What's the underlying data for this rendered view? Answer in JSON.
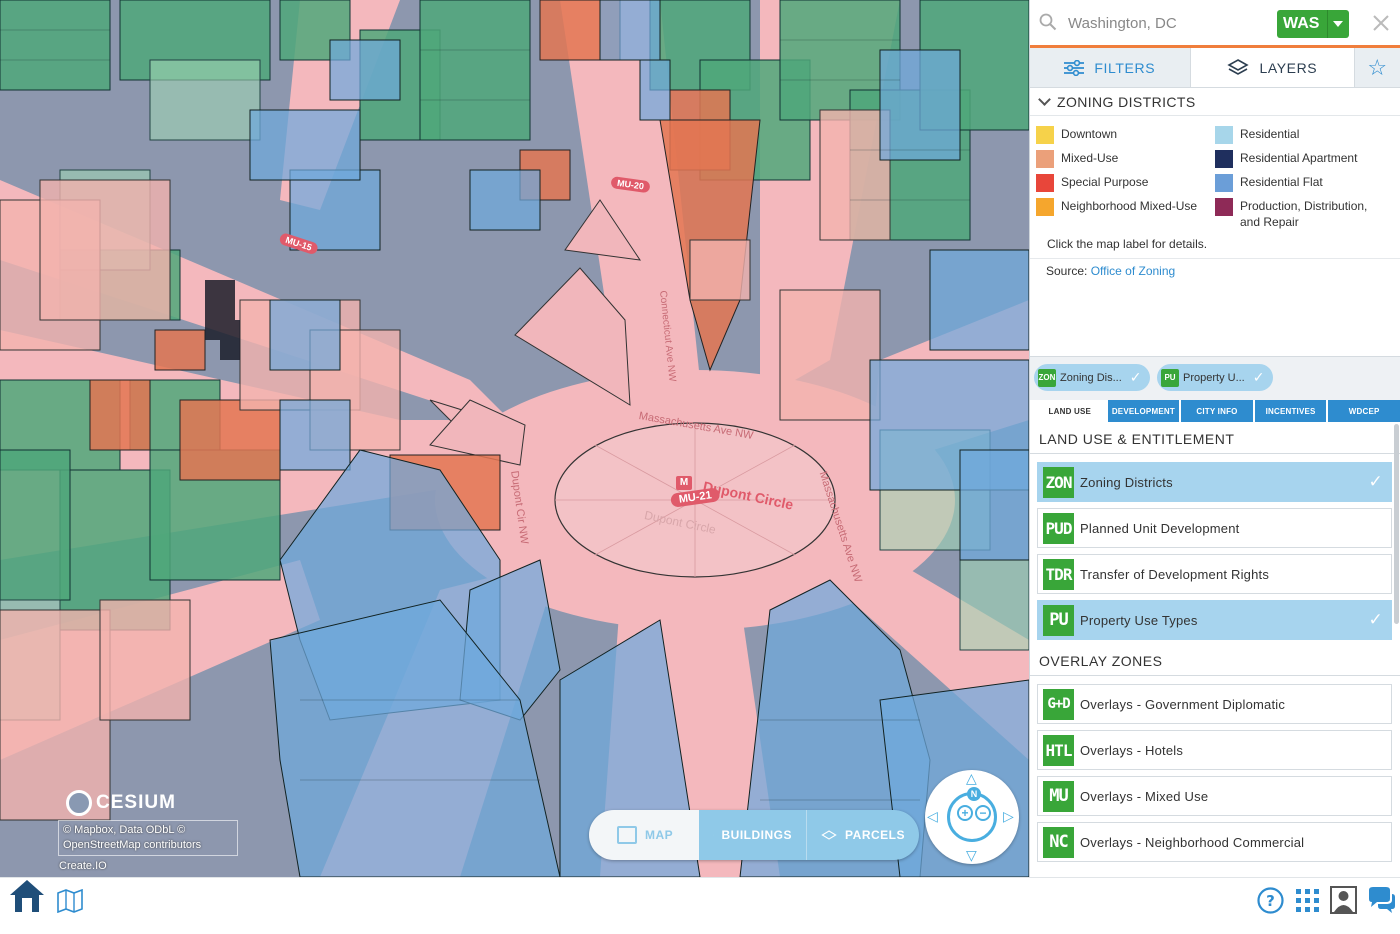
{
  "search": {
    "placeholder": "Washington, DC",
    "city_code": "WAS"
  },
  "tabs": {
    "filters_label": "FILTERS",
    "layers_label": "LAYERS"
  },
  "zoning": {
    "heading": "ZONING DISTRICTS",
    "legend": [
      {
        "label": "Downtown",
        "color": "#f6d24a"
      },
      {
        "label": "Mixed-Use",
        "color": "#eba07a"
      },
      {
        "label": "Special Purpose",
        "color": "#e8463a"
      },
      {
        "label": "Neighborhood Mixed-Use",
        "color": "#f5a62d"
      },
      {
        "label": "Residential",
        "color": "#a7d6ea"
      },
      {
        "label": "Residential Apartment",
        "color": "#1f2f5e"
      },
      {
        "label": "Residential Flat",
        "color": "#6b9ed8"
      },
      {
        "label": "Production, Distribution, and Repair",
        "color": "#8e2a57"
      }
    ],
    "hint": "Click the map label for details.",
    "source_prefix": "Source: ",
    "source_link": "Office of Zoning"
  },
  "chips": [
    {
      "code": "ZON",
      "label": "Zoning Dis..."
    },
    {
      "code": "PU",
      "label": "Property U..."
    }
  ],
  "subtabs": [
    "LAND USE",
    "DEVELOPMENT",
    "CITY INFO",
    "INCENTIVES",
    "WDCEP"
  ],
  "land_use": {
    "heading": "LAND USE & ENTITLEMENT",
    "items": [
      {
        "code": "ZON",
        "label": "Zoning Districts",
        "selected": true
      },
      {
        "code": "PUD",
        "label": "Planned Unit Development",
        "selected": false
      },
      {
        "code": "TDR",
        "label": "Transfer of Development Rights",
        "selected": false
      },
      {
        "code": "PU",
        "label": "Property Use Types",
        "selected": true
      }
    ]
  },
  "overlay": {
    "heading": "OVERLAY ZONES",
    "items": [
      {
        "code": "G+D",
        "label": "Overlays - Government Diplomatic"
      },
      {
        "code": "HTL",
        "label": "Overlays - Hotels"
      },
      {
        "code": "MU",
        "label": "Overlays - Mixed Use"
      },
      {
        "code": "NC",
        "label": "Overlays - Neighborhood Commercial"
      }
    ]
  },
  "map": {
    "modes": {
      "map": "MAP",
      "buildings": "BUILDINGS",
      "parcels": "PARCELS"
    },
    "cesium": "CESIUM",
    "attribution_1": "© Mapbox, Data ODbL ©",
    "attribution_2": "OpenStreetMap contributors",
    "credit": "Create.IO",
    "labels": {
      "circle": "Dupont Circle",
      "circle_ghost": "Dupont Circle",
      "zone_main": "MU-21",
      "zone_a": "MU-20",
      "zone_b": "MU-15",
      "mass_ave_top": "Massachusetts Ave NW",
      "mass_ave_right": "Massachusetts Ave NW",
      "dupont_cir": "Dupont Cir NW",
      "connecticut": "Connecticut Ave NW",
      "metro": "M",
      "north": "N"
    }
  },
  "colors": {
    "accent_blue": "#2e8ccf",
    "accent_green": "#39a639",
    "accent_orange": "#f07e3c",
    "selected_bg": "#a7d4ee"
  }
}
